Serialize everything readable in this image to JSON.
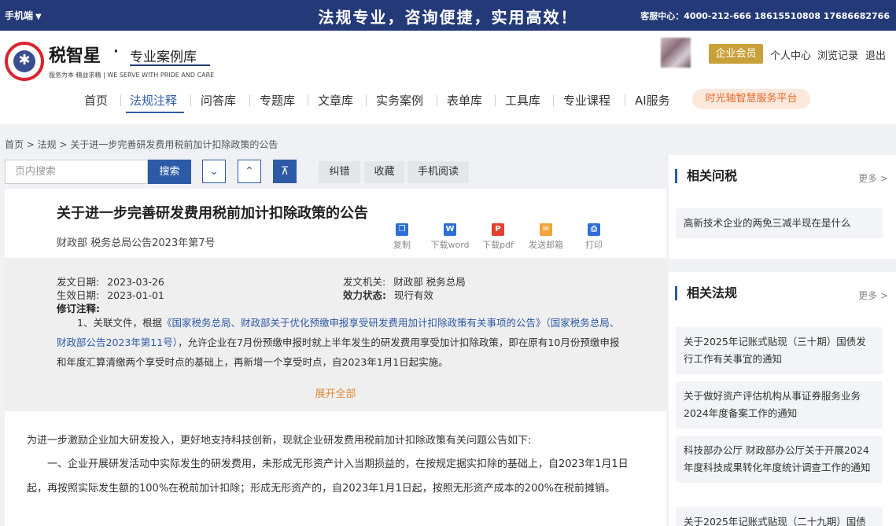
{
  "topbar": {
    "mobile_label": "手机端",
    "slogan": "法规专业，咨询便捷，实用高效！",
    "hotline": "客服中心：4000-212-666 18615510808 17686682766"
  },
  "header": {
    "brand_name": "税智星",
    "brand_dot": "·",
    "brand_sub": "专业案例库",
    "brand_tagline": "服务为本·精益求精 | WE SERVE WITH PRIDE AND CARE",
    "vip_label": "企业会员",
    "user_links": [
      "个人中心",
      "浏览记录",
      "退出"
    ]
  },
  "nav": {
    "items": [
      "首页",
      "法规注释",
      "问答库",
      "专题库",
      "文章库",
      "实务案例",
      "表单库",
      "工具库",
      "专业课程",
      "AI服务"
    ],
    "active_index": 1,
    "promo": "时光轴智慧服务平台"
  },
  "breadcrumb": "首页 > 法规 > 关于进一步完善研发费用税前加计扣除政策的公告",
  "search": {
    "placeholder": "页内搜索",
    "button": "搜索"
  },
  "tools": [
    "纠错",
    "收藏",
    "手机阅读"
  ],
  "article": {
    "title": "关于进一步完善研发费用税前加计扣除政策的公告",
    "subtitle": "财政部 税务总局公告2023年第7号",
    "actions": [
      {
        "icon": "copy-icon",
        "label": "复制",
        "color": "#2d6fd6"
      },
      {
        "icon": "word-icon",
        "label": "下载word",
        "color": "#2d6fd6"
      },
      {
        "icon": "pdf-icon",
        "label": "下载pdf",
        "color": "#e0412f"
      },
      {
        "icon": "mail-icon",
        "label": "发送邮箱",
        "color": "#f0a43a"
      },
      {
        "icon": "print-icon",
        "label": "打印",
        "color": "#2d6fd6"
      }
    ]
  },
  "meta": {
    "issue_date_key": "发文日期:",
    "issue_date": "2023-03-26",
    "effective_date_key": "生效日期:",
    "effective_date": "2023-01-01",
    "issuer_key": "发文机关:",
    "issuer": "财政部 税务总局",
    "status_key": "效力状态:",
    "status": "现行有效",
    "note_key": "修订注释:",
    "note_prefix": "1、关联文件，根据",
    "note_link": "《国家税务总局、财政部关于优化预缴申报享受研发费用加计扣除政策有关事项的公告》（国家税务总局、财政部公告2023年第11号）",
    "note_suffix": "，允许企业在7月份预缴申报时就上半年发生的研发费用享受加计扣除政策，即在原有10月份预缴申报和年度汇算清缴两个享受时点的基础上，再新增一个享受时点，自2023年1月1日起实施。",
    "expand": "展开全部"
  },
  "body": {
    "para1": "为进一步激励企业加大研发投入，更好地支持科技创新，现就企业研发费用税前加计扣除政策有关问题公告如下:",
    "para2": "一、企业开展研发活动中实际发生的研发费用，未形成无形资产计入当期损益的，在按规定据实扣除的基础上，自2023年1月1日起，再按照实际发生额的100%在税前加计扣除；形成无形资产的，自2023年1月1日起，按照无形资产成本的200%在税前摊销。"
  },
  "sidebar": {
    "more_label": "更多 >",
    "qa": {
      "title": "相关问税",
      "items": [
        "高新技术企业的两免三减半现在是什么"
      ]
    },
    "laws": {
      "title": "相关法规",
      "items": [
        "关于2025年记账式贴现（三十期）国债发行工作有关事宜的通知",
        "关于做好资产评估机构从事证券服务业务2024年度备案工作的通知",
        "科技部办公厅 财政部办公厅关于开展2024年度科技成果转化年度统计调查工作的通知",
        "关于2025年记账式贴现（二十九期）国债"
      ]
    }
  }
}
